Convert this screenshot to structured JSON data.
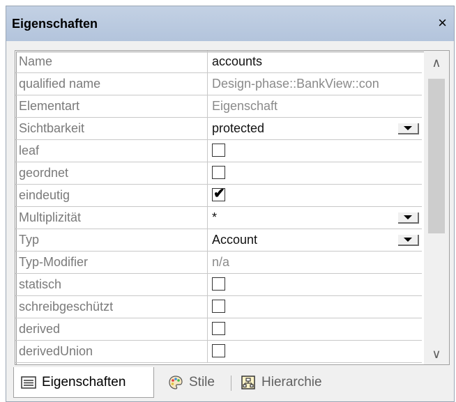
{
  "panel": {
    "title": "Eigenschaften",
    "close_label": "×"
  },
  "rows": [
    {
      "name": "Name",
      "value": "accounts",
      "kind": "text",
      "style": "dark"
    },
    {
      "name": "qualified name",
      "value": "Design-phase::BankView::con",
      "kind": "text",
      "style": "muted"
    },
    {
      "name": "Elementart",
      "value": "Eigenschaft",
      "kind": "text",
      "style": "muted"
    },
    {
      "name": "Sichtbarkeit",
      "value": "protected",
      "kind": "dropdown",
      "style": "dark"
    },
    {
      "name": "leaf",
      "checked": false,
      "kind": "checkbox"
    },
    {
      "name": "geordnet",
      "checked": false,
      "kind": "checkbox"
    },
    {
      "name": "eindeutig",
      "checked": true,
      "kind": "checkbox"
    },
    {
      "name": "Multiplizität",
      "value": "*",
      "kind": "dropdown",
      "style": "dark"
    },
    {
      "name": "Typ",
      "value": "Account",
      "kind": "dropdown",
      "style": "dark"
    },
    {
      "name": "Typ-Modifier",
      "value": "n/a",
      "kind": "text",
      "style": "muted"
    },
    {
      "name": "statisch",
      "checked": false,
      "kind": "checkbox"
    },
    {
      "name": "schreibgeschützt",
      "checked": false,
      "kind": "checkbox"
    },
    {
      "name": "derived",
      "checked": false,
      "kind": "checkbox"
    },
    {
      "name": "derivedUnion",
      "checked": false,
      "kind": "checkbox"
    }
  ],
  "tabs": [
    {
      "label": "Eigenschaften",
      "icon": "properties-icon",
      "active": true
    },
    {
      "label": "Stile",
      "icon": "palette-icon",
      "active": false
    },
    {
      "label": "Hierarchie",
      "icon": "hierarchy-icon",
      "active": false
    }
  ]
}
